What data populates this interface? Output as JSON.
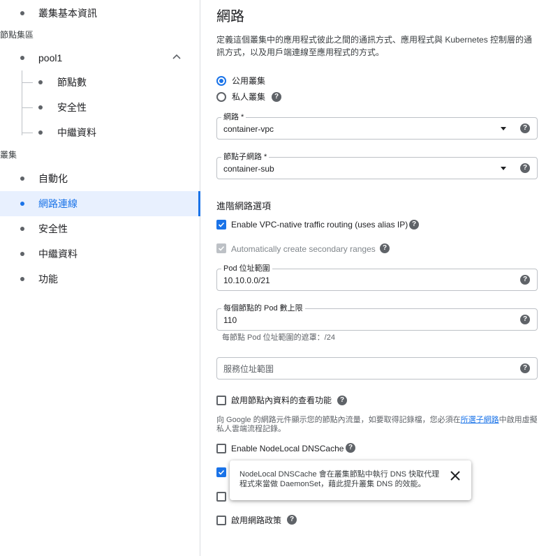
{
  "sidebar": {
    "cluster_basics": "叢集基本資訊",
    "node_pools_section": "節點集區",
    "pool_name": "pool1",
    "pool_children": [
      "節點數",
      "安全性",
      "中繼資料"
    ],
    "cluster_section": "叢集",
    "cluster_items": [
      "自動化",
      "網路連線",
      "安全性",
      "中繼資料",
      "功能"
    ],
    "active_item": "網路連線"
  },
  "main": {
    "title": "網路",
    "description": "定義這個叢集中的應用程式彼此之間的通訊方式、應用程式與 Kubernetes 控制層的通訊方式，以及用戶端連線至應用程式的方式。",
    "radio_public": "公用叢集",
    "radio_private": "私人叢集",
    "network_field": {
      "label": "網路 *",
      "value": "container-vpc"
    },
    "subnet_field": {
      "label": "節點子網路 *",
      "value": "container-sub"
    },
    "advanced_heading": "進階網路選項",
    "vpc_native": "Enable VPC-native traffic routing (uses alias IP)",
    "auto_secondary": "Automatically create secondary ranges",
    "pod_range": {
      "label": "Pod 位址範圍",
      "value": "10.10.0.0/21"
    },
    "max_pods": {
      "label": "每個節點的 Pod 數上限",
      "value": "110"
    },
    "pod_mask_hint": "每節點 Pod 位址範圍的遮罩：/24",
    "service_range_placeholder": "服務位址範圍",
    "intranode_visibility": "啟用節點內資料的查看功能",
    "intranode_note_before": "向 Google 的網路元件顯示您的節點內流量，如要取得記錄檔，您必須在",
    "intranode_note_link": "所選子網路",
    "intranode_note_after": "中啟用虛擬私人雲端流程記錄。",
    "nodelocal_dns": "Enable NodeLocal DNSCache",
    "network_policy": "啟用網路政策"
  },
  "tooltip": {
    "text": "NodeLocal DNSCache 會在叢集節點中執行 DNS 快取代理程式來當做 DaemonSet，藉此提升叢集 DNS 的效能。"
  },
  "colors": {
    "accent": "#1a73e8",
    "active_bg": "#e8f0fe",
    "border": "#dadce0"
  }
}
